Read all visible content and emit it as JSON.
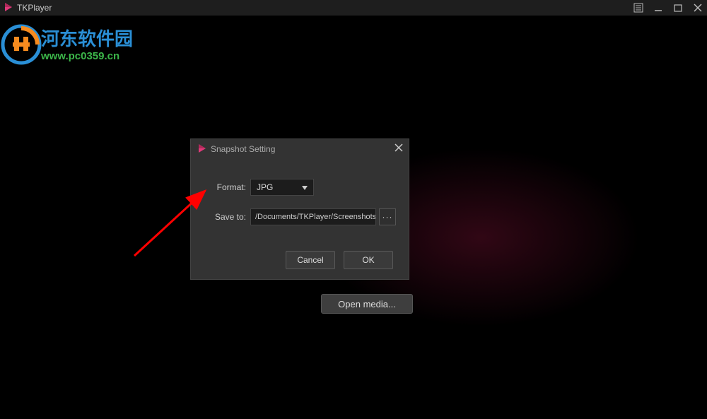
{
  "window": {
    "title": "TKPlayer"
  },
  "content": {
    "open_media_label": "Open media..."
  },
  "dialog": {
    "title": "Snapshot Setting",
    "format_label": "Format:",
    "format_value": "JPG",
    "saveto_label": "Save to:",
    "saveto_value": "/Documents/TKPlayer/Screenshots/",
    "browse_label": "···",
    "cancel_label": "Cancel",
    "ok_label": "OK"
  },
  "watermark": {
    "text_cn": "河东软件园",
    "text_url": "www.pc0359.cn"
  }
}
